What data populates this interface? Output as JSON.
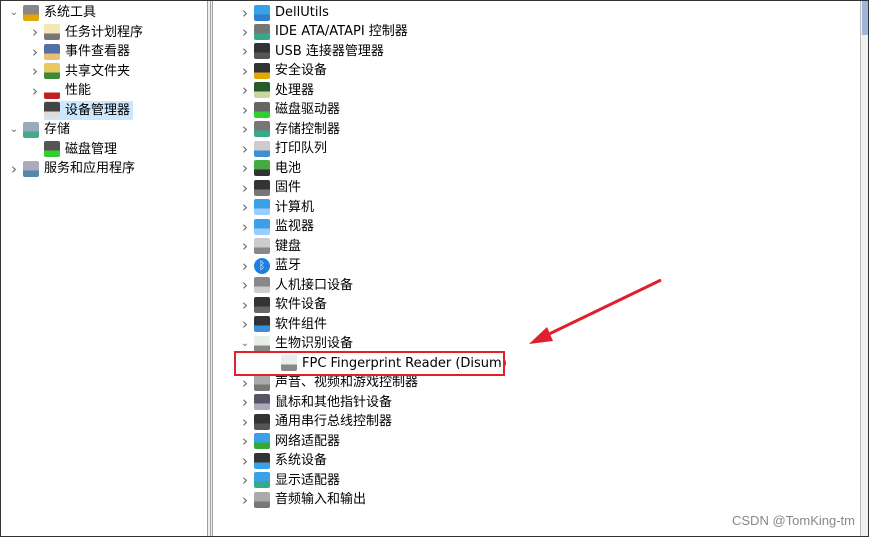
{
  "colors": {
    "accent_red": "#e0202a",
    "selection": "#cce8ff"
  },
  "left_tree": [
    {
      "label": "系统工具",
      "level": 0,
      "expander": "expanded",
      "icon": "tools-icon"
    },
    {
      "label": "任务计划程序",
      "level": 1,
      "expander": "collapsed",
      "icon": "clock-icon"
    },
    {
      "label": "事件查看器",
      "level": 1,
      "expander": "collapsed",
      "icon": "event-viewer-icon"
    },
    {
      "label": "共享文件夹",
      "level": 1,
      "expander": "collapsed",
      "icon": "shared-folder-icon"
    },
    {
      "label": "性能",
      "level": 1,
      "expander": "collapsed",
      "icon": "performance-icon"
    },
    {
      "label": "设备管理器",
      "level": 1,
      "expander": "none",
      "icon": "device-manager-icon",
      "selected": true
    },
    {
      "label": "存储",
      "level": 0,
      "expander": "expanded",
      "icon": "storage-icon"
    },
    {
      "label": "磁盘管理",
      "level": 1,
      "expander": "none",
      "icon": "disk-management-icon"
    },
    {
      "label": "服务和应用程序",
      "level": 0,
      "expander": "collapsed",
      "icon": "services-icon"
    }
  ],
  "device_tree": [
    {
      "label": "DellUtils",
      "icon": "network-monitor-icon",
      "expander": "collapsed"
    },
    {
      "label": "IDE ATA/ATAPI 控制器",
      "icon": "ide-controller-icon",
      "expander": "collapsed"
    },
    {
      "label": "USB 连接器管理器",
      "icon": "usb-plug-icon",
      "expander": "collapsed"
    },
    {
      "label": "安全设备",
      "icon": "security-key-icon",
      "expander": "collapsed"
    },
    {
      "label": "处理器",
      "icon": "cpu-icon",
      "expander": "collapsed"
    },
    {
      "label": "磁盘驱动器",
      "icon": "disk-drive-icon",
      "expander": "collapsed"
    },
    {
      "label": "存储控制器",
      "icon": "storage-controller-icon",
      "expander": "collapsed"
    },
    {
      "label": "打印队列",
      "icon": "printer-icon",
      "expander": "collapsed"
    },
    {
      "label": "电池",
      "icon": "battery-icon",
      "expander": "collapsed"
    },
    {
      "label": "固件",
      "icon": "firmware-icon",
      "expander": "collapsed"
    },
    {
      "label": "计算机",
      "icon": "computer-icon",
      "expander": "collapsed"
    },
    {
      "label": "监视器",
      "icon": "monitor-icon",
      "expander": "collapsed"
    },
    {
      "label": "键盘",
      "icon": "keyboard-icon",
      "expander": "collapsed"
    },
    {
      "label": "蓝牙",
      "icon": "bluetooth-icon",
      "expander": "collapsed"
    },
    {
      "label": "人机接口设备",
      "icon": "hid-icon",
      "expander": "collapsed"
    },
    {
      "label": "软件设备",
      "icon": "software-device-icon",
      "expander": "collapsed"
    },
    {
      "label": "软件组件",
      "icon": "software-component-icon",
      "expander": "collapsed"
    },
    {
      "label": "生物识别设备",
      "icon": "fingerprint-icon",
      "expander": "expanded"
    },
    {
      "label": "FPC Fingerprint Reader (Disum)",
      "icon": "fingerprint-icon",
      "expander": "none",
      "child": true,
      "highlighted": true
    },
    {
      "label": "声音、视频和游戏控制器",
      "icon": "speaker-icon",
      "expander": "collapsed"
    },
    {
      "label": "鼠标和其他指针设备",
      "icon": "mouse-icon",
      "expander": "collapsed"
    },
    {
      "label": "通用串行总线控制器",
      "icon": "usb-plug-icon",
      "expander": "collapsed"
    },
    {
      "label": "网络适配器",
      "icon": "network-adapter-icon",
      "expander": "collapsed"
    },
    {
      "label": "系统设备",
      "icon": "system-device-icon",
      "expander": "collapsed"
    },
    {
      "label": "显示适配器",
      "icon": "display-adapter-icon",
      "expander": "collapsed"
    },
    {
      "label": "音频输入和输出",
      "icon": "speaker-icon",
      "expander": "collapsed"
    }
  ],
  "watermark": "CSDN @TomKing-tm"
}
